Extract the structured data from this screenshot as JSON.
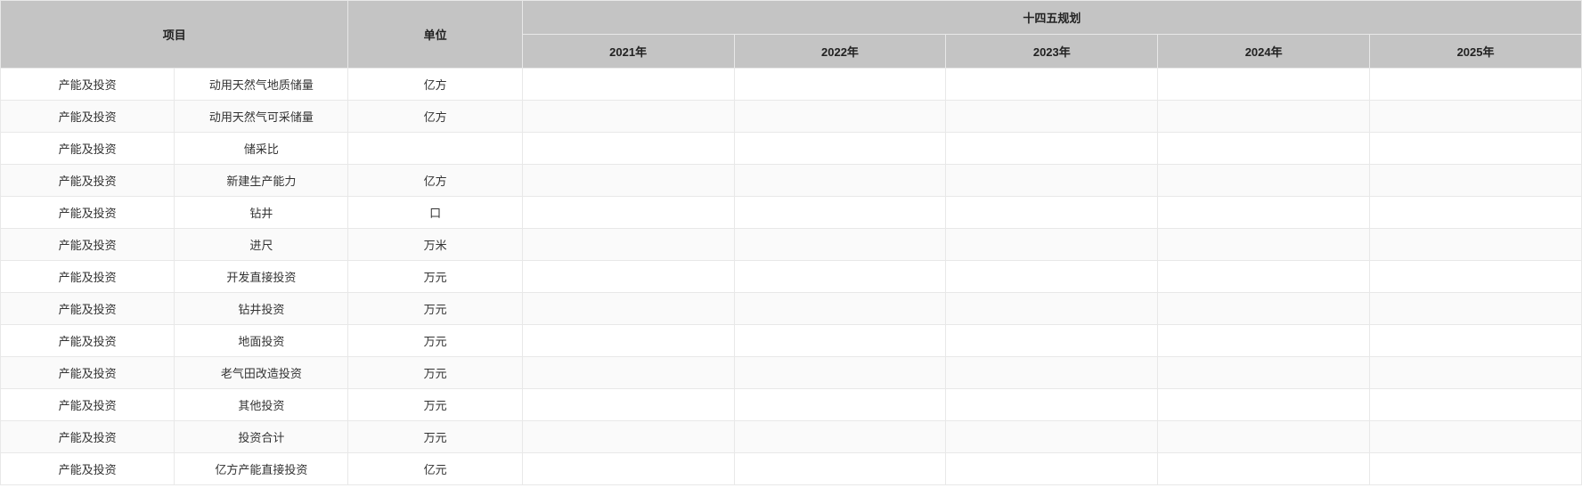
{
  "header": {
    "project": "项目",
    "unit": "单位",
    "plan_title": "十四五规划",
    "years": [
      "2021年",
      "2022年",
      "2023年",
      "2024年",
      "2025年"
    ]
  },
  "rows": [
    {
      "category": "产能及投资",
      "item": "动用天然气地质储量",
      "unit": "亿方",
      "y2021": "",
      "y2022": "",
      "y2023": "",
      "y2024": "",
      "y2025": ""
    },
    {
      "category": "产能及投资",
      "item": "动用天然气可采储量",
      "unit": "亿方",
      "y2021": "",
      "y2022": "",
      "y2023": "",
      "y2024": "",
      "y2025": ""
    },
    {
      "category": "产能及投资",
      "item": "储采比",
      "unit": "",
      "y2021": "",
      "y2022": "",
      "y2023": "",
      "y2024": "",
      "y2025": ""
    },
    {
      "category": "产能及投资",
      "item": "新建生产能力",
      "unit": "亿方",
      "y2021": "",
      "y2022": "",
      "y2023": "",
      "y2024": "",
      "y2025": ""
    },
    {
      "category": "产能及投资",
      "item": "钻井",
      "unit": "口",
      "y2021": "",
      "y2022": "",
      "y2023": "",
      "y2024": "",
      "y2025": ""
    },
    {
      "category": "产能及投资",
      "item": "进尺",
      "unit": "万米",
      "y2021": "",
      "y2022": "",
      "y2023": "",
      "y2024": "",
      "y2025": ""
    },
    {
      "category": "产能及投资",
      "item": "开发直接投资",
      "unit": "万元",
      "y2021": "",
      "y2022": "",
      "y2023": "",
      "y2024": "",
      "y2025": ""
    },
    {
      "category": "产能及投资",
      "item": "钻井投资",
      "unit": "万元",
      "y2021": "",
      "y2022": "",
      "y2023": "",
      "y2024": "",
      "y2025": ""
    },
    {
      "category": "产能及投资",
      "item": "地面投资",
      "unit": "万元",
      "y2021": "",
      "y2022": "",
      "y2023": "",
      "y2024": "",
      "y2025": ""
    },
    {
      "category": "产能及投资",
      "item": "老气田改造投资",
      "unit": "万元",
      "y2021": "",
      "y2022": "",
      "y2023": "",
      "y2024": "",
      "y2025": ""
    },
    {
      "category": "产能及投资",
      "item": "其他投资",
      "unit": "万元",
      "y2021": "",
      "y2022": "",
      "y2023": "",
      "y2024": "",
      "y2025": ""
    },
    {
      "category": "产能及投资",
      "item": "投资合计",
      "unit": "万元",
      "y2021": "",
      "y2022": "",
      "y2023": "",
      "y2024": "",
      "y2025": ""
    },
    {
      "category": "产能及投资",
      "item": "亿方产能直接投资",
      "unit": "亿元",
      "y2021": "",
      "y2022": "",
      "y2023": "",
      "y2024": "",
      "y2025": ""
    }
  ]
}
